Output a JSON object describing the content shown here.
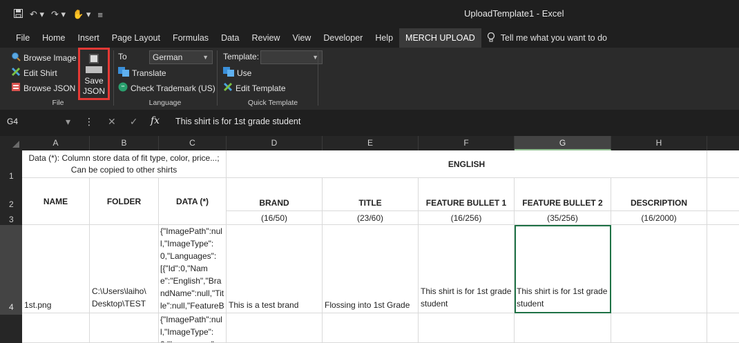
{
  "app": {
    "title": "UploadTemplate1  -  Excel",
    "colors": {
      "ribbon": "#2b2b2b",
      "titlebar": "#1f1f1f",
      "accent_selection": "#1e7145",
      "highlight": "#e53935"
    }
  },
  "quick_access": {
    "save_icon": "save-icon",
    "undo_icon": "undo-icon",
    "redo_icon": "redo-icon",
    "custom_icon": "touch-icon"
  },
  "menu": {
    "tabs": [
      "File",
      "Home",
      "Insert",
      "Page Layout",
      "Formulas",
      "Data",
      "Review",
      "View",
      "Developer",
      "Help",
      "MERCH UPLOAD"
    ],
    "tell_me": "Tell me what you want to do"
  },
  "ribbon": {
    "file_group": {
      "label": "File",
      "browse_image": "Browse Image",
      "edit_shirt": "Edit Shirt",
      "browse_json": "Browse JSON",
      "save_json": "Save JSON"
    },
    "language_group": {
      "label": "Language",
      "to_label": "To",
      "to_value": "German",
      "translate": "Translate",
      "check_trademark": "Check Trademark (US)"
    },
    "template_group": {
      "label": "Quick Template",
      "template_label": "Template:",
      "template_value": "",
      "use": "Use",
      "edit_template": "Edit Template"
    }
  },
  "formula_bar": {
    "name_box": "G4",
    "formula": "This shirt is for 1st grade student"
  },
  "columns": [
    "A",
    "B",
    "C",
    "D",
    "E",
    "F",
    "G",
    "H"
  ],
  "rows": [
    "1",
    "2",
    "3",
    "4"
  ],
  "sheet": {
    "row1_note": "Data (*): Column store data of fit type, color, price...; Can be copied to other shirts",
    "row1_english": "ENGLISH",
    "headers": {
      "name": "NAME",
      "folder": "FOLDER",
      "data": "DATA (*)",
      "brand": "BRAND",
      "title": "TITLE",
      "feature1": "FEATURE BULLET 1",
      "feature2": "FEATURE BULLET 2",
      "description": "DESCRIPTION"
    },
    "counts": {
      "brand": "(16/50)",
      "title": "(23/60)",
      "feature1": "(16/256)",
      "feature2": "(35/256)",
      "description": "(16/2000)"
    },
    "row4": {
      "name": "1st.png",
      "folder": "C:\\Users\\laiho\\ Desktop\\TEST",
      "data": "{\"ImagePath\":null,\"ImageType\":0,\"Languages\":[{\"Id\":0,\"Name\":\"English\",\"BrandName\":null,\"Title\":null,\"FeatureBull",
      "brand": "This is a test brand",
      "title": "Flossing into 1st Grade",
      "feature1": "This shirt is for 1st grade student",
      "feature2": "This shirt is for 1st grade student",
      "description": ""
    },
    "row5": {
      "data": "{\"ImagePath\":null,\"ImageType\":0,\"Languages\":[{\"I"
    }
  }
}
